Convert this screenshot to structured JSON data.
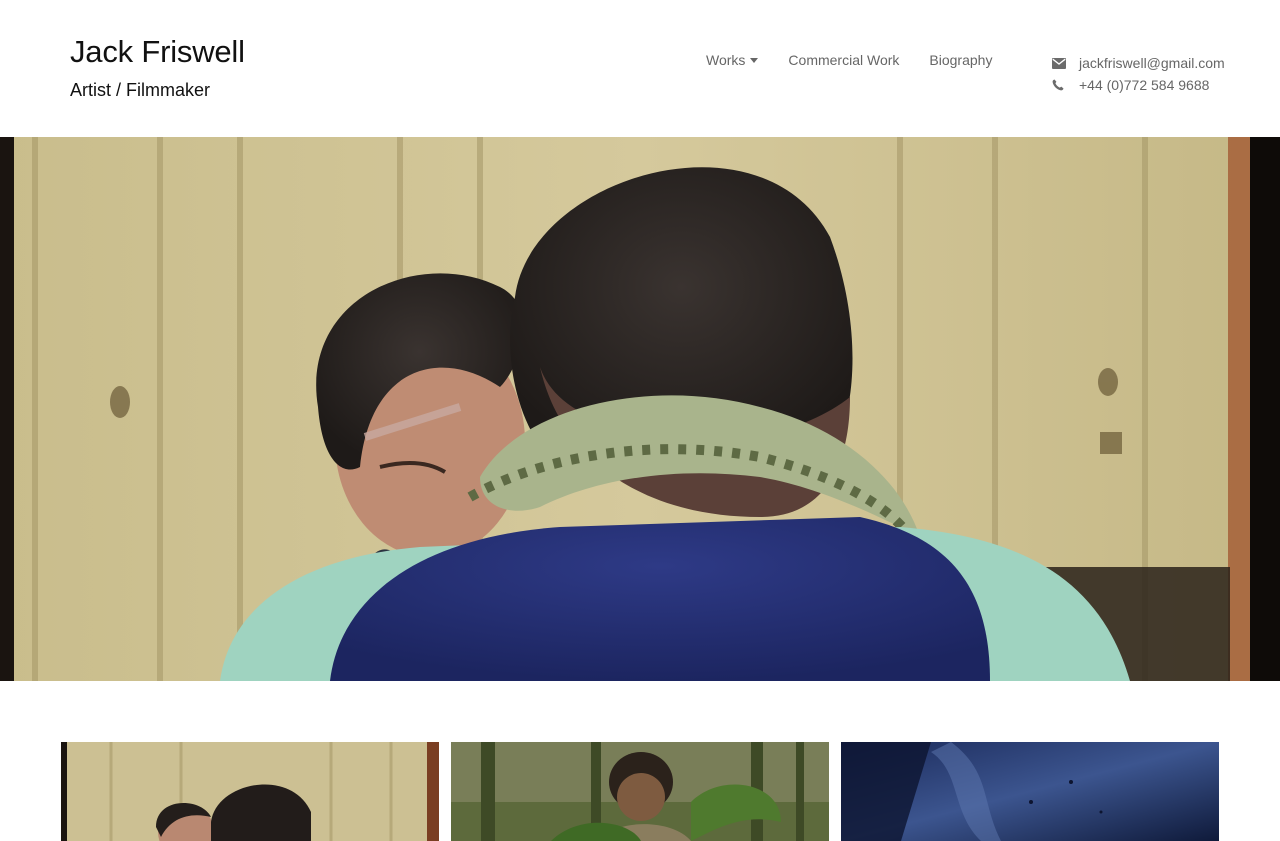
{
  "header": {
    "title": "Jack Friswell",
    "subtitle": "Artist / Filmmaker"
  },
  "nav": {
    "items": [
      {
        "label": "Works",
        "has_dropdown": true
      },
      {
        "label": "Commercial Work"
      },
      {
        "label": "Biography"
      }
    ]
  },
  "contact": {
    "email": "jackfriswell@gmail.com",
    "phone": "+44 (0)772 584 9688",
    "email_icon": "envelope-icon",
    "phone_icon": "phone-icon"
  },
  "hero": {
    "image": "film-still-snake-scene"
  },
  "thumbnails": [
    {
      "image": "film-still-snake-scene"
    },
    {
      "image": "film-still-jungle-boy"
    },
    {
      "image": "film-still-blue-wall"
    }
  ]
}
